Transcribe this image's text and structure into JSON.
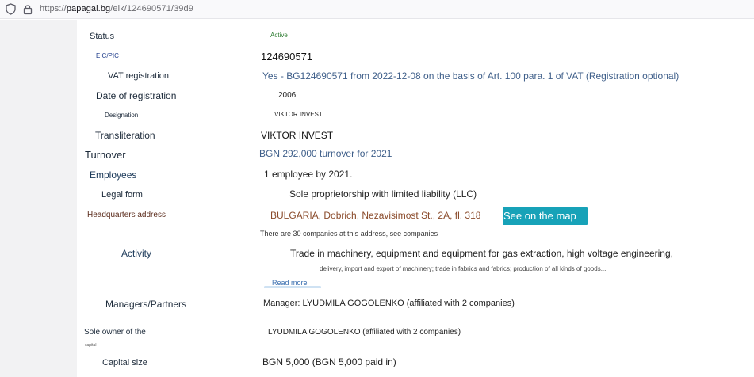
{
  "browser": {
    "url_prefix": "https://",
    "url_host": "papagal.bg",
    "url_path": "/eik/124690571/39d9"
  },
  "fields": {
    "status_label": "Status",
    "status_value": "Active",
    "eic_label": "EIC/PIC",
    "eic_value": "124690571",
    "vat_label": "VAT registration",
    "vat_value": "Yes - BG124690571 from 2022-12-08 on the basis of Art. 100 para. 1 of VAT (Registration optional)",
    "regdate_label": "Date of registration",
    "regdate_value": "2006",
    "designation_label": "Designation",
    "designation_value": "VIKTOR INVEST",
    "translit_label": "Transliteration",
    "translit_value": "VIKTOR INVEST",
    "turnover_label": "Turnover",
    "turnover_value": "BGN 292,000 turnover for 2021",
    "employees_label": "Employees",
    "employees_value": "1 employee by 2021.",
    "legalform_label": "Legal form",
    "legalform_value": "Sole proprietorship with limited liability (LLC)",
    "hq_label": "Headquarters address",
    "hq_value": "BULGARIA, Dobrich, Nezavisimost St., 2A, fl. 318",
    "map_button": "See on the map",
    "hq_note": "There are 30 companies at this address, see companies",
    "activity_label": "Activity",
    "activity_value": "Trade in machinery, equipment and equipment for gas extraction, high voltage engineering,",
    "activity_more": "delivery, import and export of machinery; trade in fabrics and fabrics; production of all kinds of goods...",
    "read_more": "Read more",
    "managers_label": "Managers/Partners",
    "managers_value": "Manager: LYUDMILA GOGOLENKO (affiliated with 2 companies)",
    "owner_label": "Sole owner of the",
    "owner_label_sub": "capital",
    "owner_value": "LYUDMILA GOGOLENKO (affiliated with 2 companies)",
    "capital_label": "Capital size",
    "capital_value": "BGN 5,000 (BGN 5,000 paid in)"
  }
}
